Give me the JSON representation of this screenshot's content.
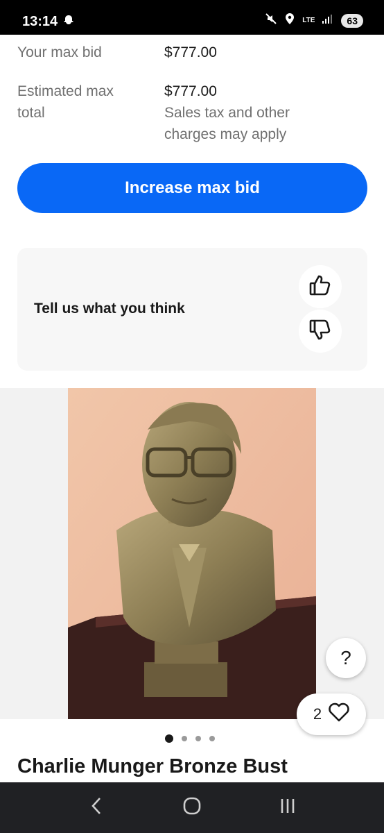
{
  "status_bar": {
    "time": "13:14",
    "network": "LTE",
    "battery": "63",
    "icons": [
      "snapchat-ghost-icon",
      "mute-icon",
      "location-icon",
      "signal-icon"
    ]
  },
  "bid_summary": {
    "max_bid_label": "Your max bid",
    "max_bid_value": "$777.00",
    "estimated_label": "Estimated max total",
    "estimated_value": "$777.00",
    "estimated_note": "Sales tax and other charges may apply"
  },
  "increase_button": {
    "label": "Increase max bid",
    "color": "#0968f6"
  },
  "feedback": {
    "title": "Tell us what you think",
    "thumbs_up_icon": "thumbs-up-icon",
    "thumbs_down_icon": "thumbs-down-icon"
  },
  "gallery": {
    "image_icon": "bronze-bust-photo",
    "total_images": 4,
    "active_index": 0,
    "help_label": "?",
    "watch_count": "2"
  },
  "listing": {
    "title": "Charlie Munger Bronze Bust"
  },
  "nav_bar": {
    "icons": [
      "back-icon",
      "home-icon",
      "recents-icon"
    ]
  }
}
